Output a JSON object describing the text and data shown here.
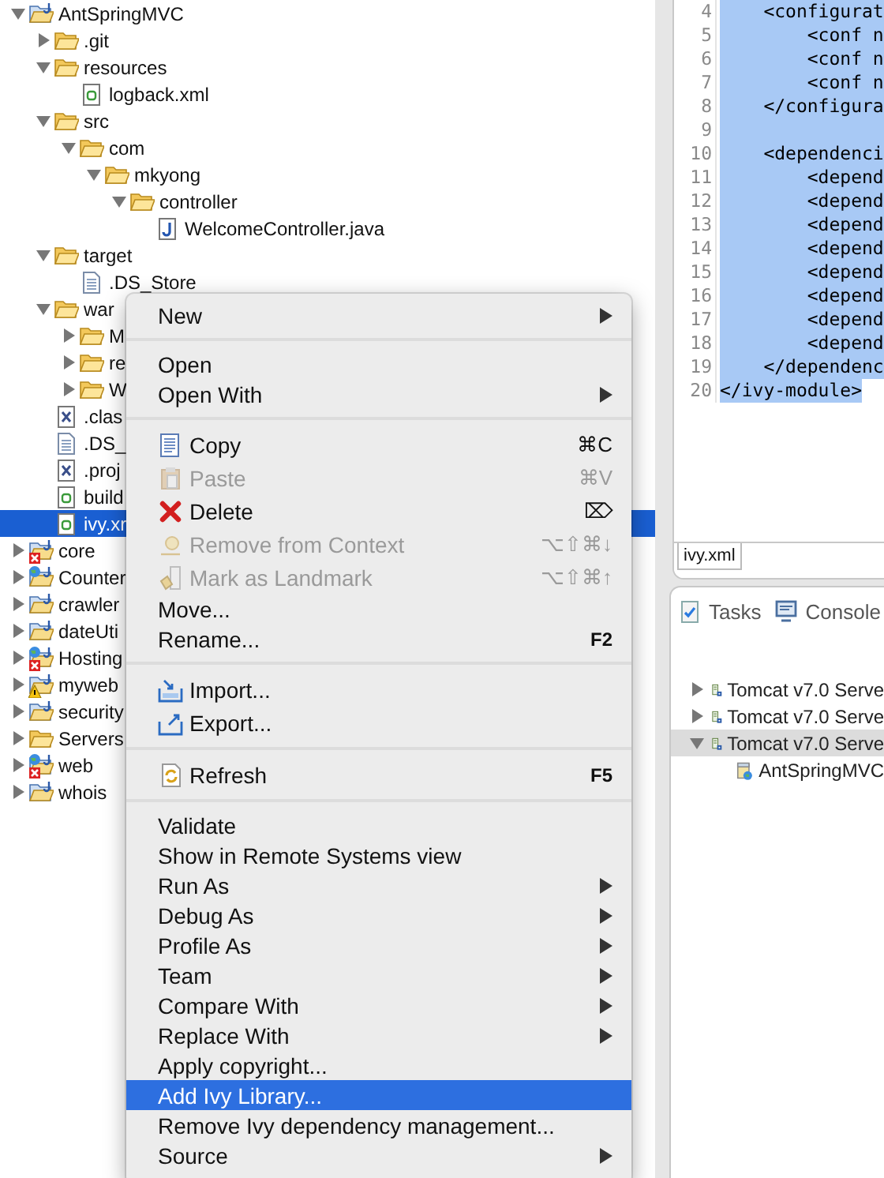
{
  "explorer": {
    "tree": [
      {
        "label": "AntSpringMVC",
        "kind": "project",
        "expanded": true,
        "selected": false,
        "children": [
          {
            "label": ".git",
            "kind": "folder",
            "expanded": false,
            "selected": false
          },
          {
            "label": "resources",
            "kind": "folder",
            "expanded": true,
            "selected": false,
            "children": [
              {
                "label": "logback.xml",
                "kind": "xml",
                "selected": false
              }
            ]
          },
          {
            "label": "src",
            "kind": "folder",
            "expanded": true,
            "selected": false,
            "children": [
              {
                "label": "com",
                "kind": "folder",
                "expanded": true,
                "selected": false,
                "children": [
                  {
                    "label": "mkyong",
                    "kind": "folder",
                    "expanded": true,
                    "selected": false,
                    "children": [
                      {
                        "label": "controller",
                        "kind": "folder",
                        "expanded": true,
                        "selected": false,
                        "children": [
                          {
                            "label": "WelcomeController.java",
                            "kind": "java",
                            "selected": false
                          }
                        ]
                      }
                    ]
                  }
                ]
              }
            ]
          },
          {
            "label": "target",
            "kind": "folder",
            "expanded": true,
            "selected": false,
            "children": [
              {
                "label": ".DS_Store",
                "kind": "text",
                "selected": false
              }
            ]
          },
          {
            "label": "war",
            "kind": "folder",
            "expanded": true,
            "selected": false,
            "children": [
              {
                "label": "M",
                "kind": "folder",
                "expanded": false,
                "selected": false
              },
              {
                "label": "re",
                "kind": "folder",
                "expanded": false,
                "selected": false
              },
              {
                "label": "W",
                "kind": "folder",
                "expanded": false,
                "selected": false
              }
            ]
          },
          {
            "label": ".clas",
            "kind": "xfile",
            "selected": false
          },
          {
            "label": ".DS_",
            "kind": "text",
            "selected": false
          },
          {
            "label": ".proj",
            "kind": "xfile",
            "selected": false
          },
          {
            "label": "build",
            "kind": "xml",
            "selected": false
          },
          {
            "label": "ivy.xr",
            "kind": "xml",
            "selected": true
          }
        ]
      },
      {
        "label": "core",
        "kind": "errorproject",
        "expanded": false,
        "selected": false
      },
      {
        "label": "Counter",
        "kind": "webproject",
        "expanded": false,
        "selected": false
      },
      {
        "label": "crawler",
        "kind": "project",
        "expanded": false,
        "selected": false
      },
      {
        "label": "dateUti",
        "kind": "project",
        "expanded": false,
        "selected": false
      },
      {
        "label": "Hosting",
        "kind": "weberrorproject",
        "expanded": false,
        "selected": false
      },
      {
        "label": "myweb",
        "kind": "warningproject",
        "expanded": false,
        "selected": false
      },
      {
        "label": "security",
        "kind": "project",
        "expanded": false,
        "selected": false
      },
      {
        "label": "Servers",
        "kind": "folder",
        "expanded": false,
        "selected": false
      },
      {
        "label": "web",
        "kind": "weberrorproject",
        "expanded": false,
        "selected": false
      },
      {
        "label": "whois",
        "kind": "project",
        "expanded": false,
        "selected": false
      }
    ]
  },
  "context_menu": {
    "groups": [
      [
        {
          "label": "New",
          "submenu": true,
          "disabled": false,
          "selected": false
        }
      ],
      [
        {
          "label": "Open",
          "disabled": false,
          "selected": false
        },
        {
          "label": "Open With",
          "submenu": true,
          "disabled": false,
          "selected": false
        }
      ],
      [
        {
          "label": "Copy",
          "kind": "copy",
          "shortcut": "⌘C",
          "disabled": false,
          "selected": false
        },
        {
          "label": "Paste",
          "kind": "paste",
          "shortcut": "⌘V",
          "disabled": true,
          "selected": false
        },
        {
          "label": "Delete",
          "kind": "delete",
          "shortcut": "⌦",
          "disabled": false,
          "selected": false
        },
        {
          "label": "Remove from Context",
          "kind": "context",
          "shortcut": "⌥⇧⌘↓",
          "disabled": true,
          "selected": false
        },
        {
          "label": "Mark as Landmark",
          "kind": "landmark",
          "shortcut": "⌥⇧⌘↑",
          "disabled": true,
          "selected": false
        },
        {
          "label": "Move...",
          "disabled": false,
          "selected": false
        },
        {
          "label": "Rename...",
          "shortcut": "F2",
          "disabled": false,
          "selected": false
        }
      ],
      [
        {
          "label": "Import...",
          "kind": "import",
          "disabled": false,
          "selected": false
        },
        {
          "label": "Export...",
          "kind": "export",
          "disabled": false,
          "selected": false
        }
      ],
      [
        {
          "label": "Refresh",
          "kind": "refresh",
          "shortcut": "F5",
          "disabled": false,
          "selected": false
        }
      ],
      [
        {
          "label": "Validate",
          "disabled": false,
          "selected": false
        },
        {
          "label": "Show in Remote Systems view",
          "disabled": false,
          "selected": false
        },
        {
          "label": "Run As",
          "submenu": true,
          "disabled": false,
          "selected": false
        },
        {
          "label": "Debug As",
          "submenu": true,
          "disabled": false,
          "selected": false
        },
        {
          "label": "Profile As",
          "submenu": true,
          "disabled": false,
          "selected": false
        },
        {
          "label": "Team",
          "submenu": true,
          "disabled": false,
          "selected": false
        },
        {
          "label": "Compare With",
          "submenu": true,
          "disabled": false,
          "selected": false
        },
        {
          "label": "Replace With",
          "submenu": true,
          "disabled": false,
          "selected": false
        },
        {
          "label": "Apply copyright...",
          "disabled": false,
          "selected": false
        },
        {
          "label": "Add Ivy Library...",
          "disabled": false,
          "selected": true
        },
        {
          "label": "Remove Ivy dependency management...",
          "disabled": false,
          "selected": false
        },
        {
          "label": "Source",
          "submenu": true,
          "disabled": false,
          "selected": false
        }
      ]
    ]
  },
  "editor": {
    "lines": [
      {
        "number": "4",
        "code": "    <configurat",
        "selected": true
      },
      {
        "number": "5",
        "code": "        <conf n",
        "selected": true
      },
      {
        "number": "6",
        "code": "        <conf n",
        "selected": true
      },
      {
        "number": "7",
        "code": "        <conf n",
        "selected": true
      },
      {
        "number": "8",
        "code": "    </configura",
        "selected": true
      },
      {
        "number": "9",
        "selected": true
      },
      {
        "number": "10",
        "code": "    <dependenci",
        "selected": true
      },
      {
        "number": "11",
        "code": "        <depend",
        "selected": true
      },
      {
        "number": "12",
        "code": "        <depend",
        "selected": true
      },
      {
        "number": "13",
        "code": "        <depend",
        "selected": true
      },
      {
        "number": "14",
        "code": "        <depend",
        "selected": true
      },
      {
        "number": "15",
        "code": "        <depend",
        "selected": true
      },
      {
        "number": "16",
        "code": "        <depend",
        "selected": true
      },
      {
        "number": "17",
        "code": "        <depend",
        "selected": true
      },
      {
        "number": "18",
        "code": "        <depend",
        "selected": true
      },
      {
        "number": "19",
        "code": "    </dependenc",
        "selected": true
      },
      {
        "number": "20",
        "code": "</ivy-module>",
        "selected": true
      }
    ],
    "tabs": [
      {
        "label": "ivy.xml",
        "selected": true
      }
    ]
  },
  "servers_panel": {
    "tabs": [
      {
        "label": "Tasks",
        "kind": "tasks",
        "selected": false
      },
      {
        "label": "Console",
        "kind": "console",
        "selected": false
      }
    ],
    "servers": [
      {
        "label": "Tomcat v7.0 Serve",
        "expanded": false,
        "selected": false
      },
      {
        "label": "Tomcat v7.0 Serve",
        "expanded": false,
        "selected": false
      },
      {
        "label": "Tomcat v7.0 Serve",
        "expanded": true,
        "selected": true,
        "children": [
          {
            "label": "AntSpringMVC",
            "selected": false
          }
        ]
      }
    ]
  }
}
